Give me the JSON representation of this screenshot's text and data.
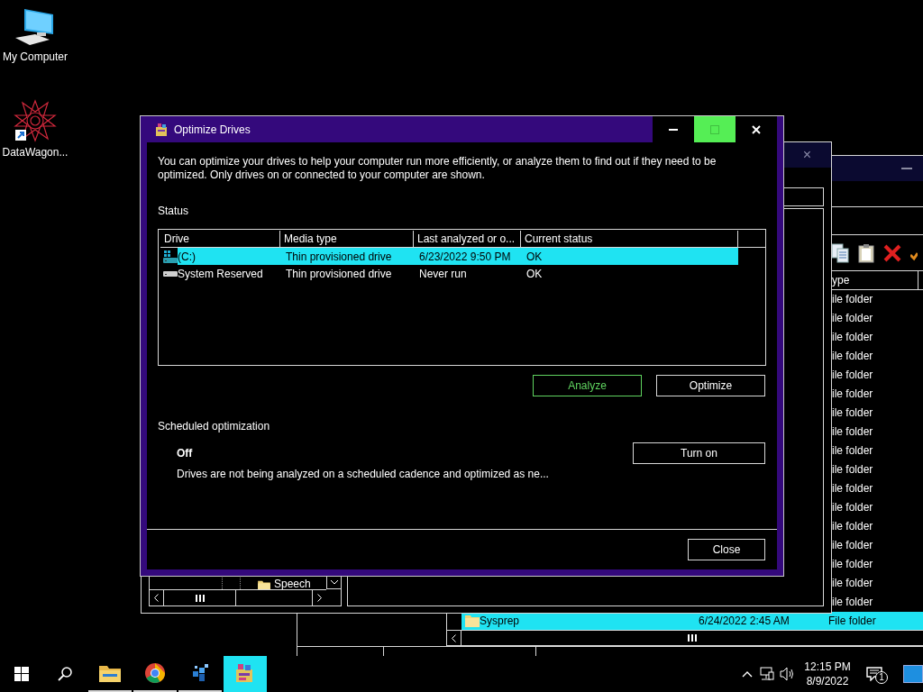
{
  "desktop_icons": [
    {
      "kind": "computer",
      "label": "My Computer"
    },
    {
      "kind": "star",
      "label": "DataWagon..."
    }
  ],
  "explorer": {
    "type_header": "ype",
    "rows": [
      {
        "type": "ile folder"
      },
      {
        "type": "ile folder"
      },
      {
        "type": "ile folder"
      },
      {
        "type": "ile folder"
      },
      {
        "type": "ile folder"
      },
      {
        "type": "ile folder"
      },
      {
        "type": "ile folder"
      },
      {
        "type": "ile folder"
      },
      {
        "type": "ile folder"
      },
      {
        "type": "ile folder"
      },
      {
        "type": "ile folder"
      },
      {
        "type": "ile folder"
      },
      {
        "type": "ile folder"
      },
      {
        "type": "ile folder"
      },
      {
        "type": "ile folder"
      },
      {
        "type": "ile folder"
      },
      {
        "type": "ile folder"
      }
    ],
    "selected_row": {
      "name": "Sysprep",
      "date": "6/24/2022 2:45 AM",
      "type": "File folder",
      "selected": true
    }
  },
  "folder_window": {
    "close": "×",
    "tree_item": "Speech"
  },
  "dialog": {
    "title": "Optimize Drives",
    "window_controls": [
      {
        "kind": "minimize",
        "hovered": false
      },
      {
        "kind": "maximize",
        "hovered": true
      },
      {
        "kind": "close",
        "hovered": false
      }
    ],
    "description": "You can optimize your drives to help your computer run more efficiently, or analyze them to find out if they need to be optimized. Only drives on or connected to your computer are shown.",
    "status_label": "Status",
    "columns": [
      "Drive",
      "Media type",
      "Last analyzed or o...",
      "Current status"
    ],
    "rows": [
      {
        "kind": "system",
        "drive": "(C:)",
        "media_type": "Thin provisioned drive",
        "last_analyzed": "6/23/2022 9:50 PM",
        "current_status": "OK",
        "selected": true
      },
      {
        "kind": "plain",
        "drive": "System Reserved",
        "media_type": "Thin provisioned drive",
        "last_analyzed": "Never run",
        "current_status": "OK",
        "selected": false
      }
    ],
    "buttons": [
      {
        "label": "Analyze",
        "focused": true
      },
      {
        "label": "Optimize",
        "focused": false
      }
    ],
    "scheduled": {
      "heading": "Scheduled optimization",
      "state": "Off",
      "description": "Drives are not being analyzed on a scheduled cadence and optimized as ne...",
      "button": "Turn on"
    },
    "close_button": "Close"
  },
  "taskbar": {
    "apps": [
      {
        "kind": "folder",
        "selected": false
      },
      {
        "kind": "browser",
        "selected": false
      },
      {
        "kind": "cubes",
        "selected": false
      },
      {
        "kind": "defrag",
        "selected": true
      }
    ],
    "time": "12:15 PM",
    "date": "8/9/2022",
    "notification_count": "1"
  }
}
